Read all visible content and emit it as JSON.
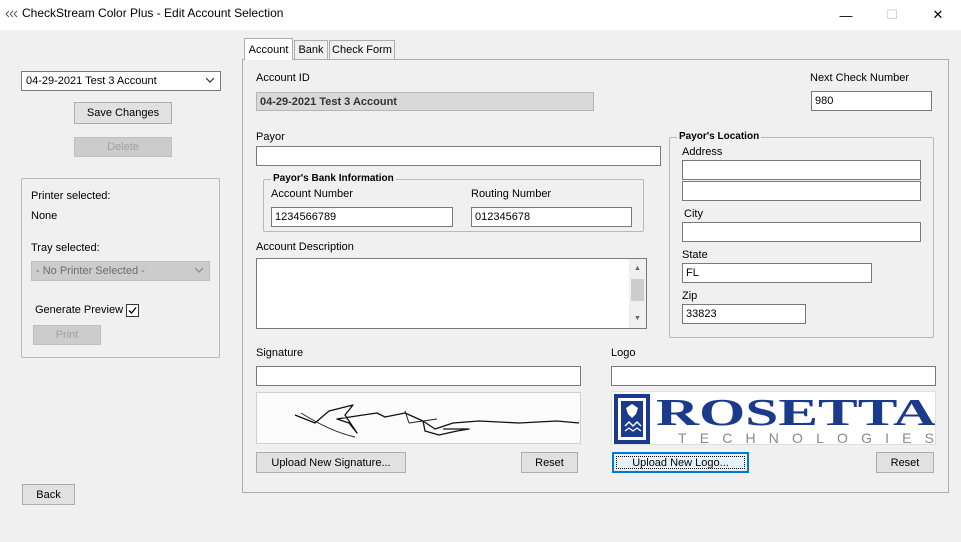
{
  "window": {
    "title": "CheckStream Color Plus - Edit Account Selection",
    "minimize": "—",
    "maximize": "☐",
    "close": "✕"
  },
  "sidebar": {
    "account_selected": "04-29-2021 Test 3 Account",
    "save_label": "Save Changes",
    "delete_label": "Delete",
    "printer_selected_label": "Printer selected:",
    "printer_value": "None",
    "tray_selected_label": "Tray selected:",
    "tray_value": "- No Printer Selected -",
    "generate_preview_label": "Generate Preview",
    "generate_preview_checked": true,
    "print_label": "Print",
    "back_label": "Back"
  },
  "tabs": [
    {
      "label": "Account",
      "active": true
    },
    {
      "label": "Bank",
      "active": false
    },
    {
      "label": "Check Form",
      "active": false
    }
  ],
  "account": {
    "account_id_label": "Account ID",
    "account_id_value": "04-29-2021 Test 3 Account",
    "next_check_label": "Next Check  Number",
    "next_check_value": "980",
    "payor_label": "Payor",
    "payor_value": "",
    "bank_info_title": "Payor's Bank Information",
    "account_number_label": "Account Number",
    "account_number_value": "1234566789",
    "routing_number_label": "Routing Number",
    "routing_number_value": "012345678",
    "description_label": "Account Description",
    "description_value": "",
    "location_title": "Payor's Location",
    "address_label": "Address",
    "address1_value": "",
    "address2_value": "",
    "city_label": "City",
    "city_value": "",
    "state_label": "State",
    "state_value": "FL",
    "zip_label": "Zip",
    "zip_value": "33823",
    "signature_label": "Signature",
    "signature_path_value": "",
    "upload_signature_label": "Upload New Signature...",
    "signature_reset_label": "Reset",
    "logo_label": "Logo",
    "logo_path_value": "",
    "upload_logo_label": "Upload New Logo...",
    "logo_reset_label": "Reset",
    "logo_text_main": "ROSETTA",
    "logo_text_sub": "TECHNOLOGIES",
    "logo_color": "#1b3a8c"
  }
}
